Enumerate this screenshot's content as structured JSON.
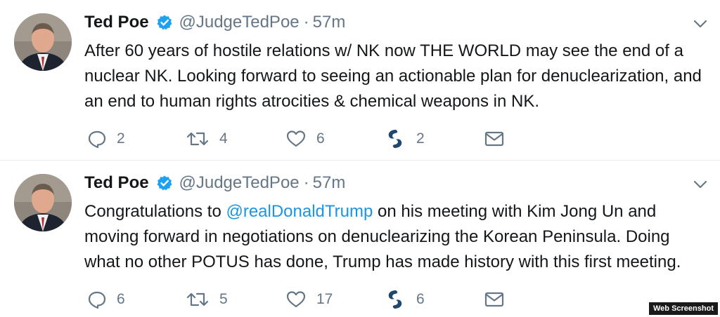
{
  "tweets": [
    {
      "author_name": "Ted Poe",
      "handle": "@JudgeTedPoe",
      "separator": "·",
      "time": "57m",
      "text_parts": [
        "After 60 years of hostile relations w/ NK now THE WORLD may see the end of a nuclear NK. Looking forward to seeing an actionable plan for denuclearization, and an end to human rights atrocities & chemical weapons in NK."
      ],
      "mention": "",
      "replies": "2",
      "retweets": "4",
      "likes": "6",
      "shares": "2"
    },
    {
      "author_name": "Ted Poe",
      "handle": "@JudgeTedPoe",
      "separator": "·",
      "time": "57m",
      "text_parts": [
        "Congratulations to ",
        " on his meeting with Kim Jong Un and moving forward in negotiations on denuclearizing the Korean Peninsula. Doing what no other POTUS has done, Trump has made history with this first meeting."
      ],
      "mention": "@realDonaldTrump",
      "replies": "6",
      "retweets": "5",
      "likes": "17",
      "shares": "6"
    }
  ],
  "watermark": "Web Screenshot",
  "icons": {
    "verified": "verified-badge-icon",
    "menu": "chevron-down-icon",
    "reply": "reply-icon",
    "retweet": "retweet-icon",
    "like": "heart-icon",
    "share": "swirl-share-icon",
    "message": "envelope-icon"
  },
  "colors": {
    "accent": "#1da1f2",
    "link": "#1b95e0",
    "secondary_text": "#657786",
    "text": "#14171a",
    "divider": "#e6ecf0"
  }
}
